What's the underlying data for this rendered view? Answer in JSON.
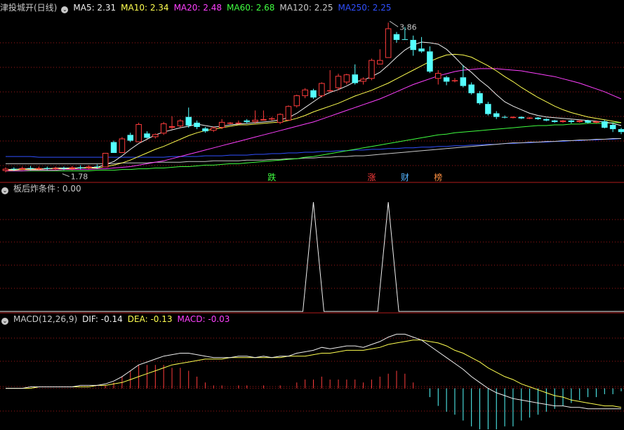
{
  "colors": {
    "background": "#000000",
    "grid": "#a01818",
    "up": "#ff3c3c",
    "down": "#54ffff",
    "text": "#c8c8c8",
    "ma5": "#f0f0f0",
    "ma10": "#ffff50",
    "ma20": "#ff40ff",
    "ma60": "#40ff40",
    "ma120": "#c8c8c8",
    "ma250": "#3050ff",
    "dif": "#f0f0f0",
    "dea": "#ffff50",
    "macd": "#ff40ff"
  },
  "main_panel": {
    "title": "津投城开(日线)",
    "ma_labels": [
      {
        "key": "ma5",
        "text": "MA5: 2.31"
      },
      {
        "key": "ma10",
        "text": "MA10: 2.34"
      },
      {
        "key": "ma20",
        "text": "MA20: 2.48"
      },
      {
        "key": "ma60",
        "text": "MA60: 2.68"
      },
      {
        "key": "ma120",
        "text": "MA120: 2.25"
      },
      {
        "key": "ma250",
        "text": "MA250: 2.25"
      }
    ],
    "high_label": "3.86",
    "low_label": "1.78",
    "markers": [
      {
        "text": "跌",
        "color": "#40ff40",
        "bar": 32
      },
      {
        "text": "涨",
        "color": "#ff3c3c",
        "bar": 44
      },
      {
        "text": "财",
        "color": "#54b4ff",
        "bar": 48
      },
      {
        "text": "榜",
        "color": "#ff9040",
        "bar": 52
      }
    ]
  },
  "indicator_panel": {
    "title": "板后炸条件",
    "value_text": ": 0.00"
  },
  "macd_panel": {
    "title": "MACD(12,26,9)",
    "dif_text": "DIF: -0.14",
    "dea_text": "DEA: -0.13",
    "macd_text": "MACD: -0.03"
  },
  "chart_data": {
    "type": "candlestick",
    "ylim": [
      1.66,
      3.96
    ],
    "candles": [
      [
        1.8,
        1.83,
        1.78,
        1.85
      ],
      [
        1.83,
        1.82,
        1.8,
        1.85
      ],
      [
        1.82,
        1.84,
        1.81,
        1.86
      ],
      [
        1.84,
        1.83,
        1.81,
        1.87
      ],
      [
        1.83,
        1.84,
        1.81,
        1.86
      ],
      [
        1.84,
        1.83,
        1.81,
        1.86
      ],
      [
        1.83,
        1.84,
        1.81,
        1.86
      ],
      [
        1.84,
        1.83,
        1.81,
        1.86
      ],
      [
        1.83,
        1.85,
        1.81,
        1.87
      ],
      [
        1.85,
        1.84,
        1.82,
        1.88
      ],
      [
        1.84,
        1.86,
        1.82,
        1.88
      ],
      [
        1.86,
        1.85,
        1.83,
        1.89
      ],
      [
        1.85,
        2.05,
        1.85,
        2.05
      ],
      [
        2.2,
        2.05,
        2.05,
        2.22
      ],
      [
        2.05,
        2.25,
        2.05,
        2.27
      ],
      [
        2.3,
        2.22,
        2.2,
        2.33
      ],
      [
        2.2,
        2.45,
        2.2,
        2.47
      ],
      [
        2.32,
        2.26,
        2.25,
        2.35
      ],
      [
        2.27,
        2.31,
        2.25,
        2.32
      ],
      [
        2.32,
        2.46,
        2.3,
        2.48
      ],
      [
        2.4,
        2.42,
        2.38,
        2.56
      ],
      [
        2.42,
        2.5,
        2.4,
        2.52
      ],
      [
        2.55,
        2.43,
        2.4,
        2.68
      ],
      [
        2.47,
        2.41,
        2.38,
        2.5
      ],
      [
        2.39,
        2.35,
        2.33,
        2.41
      ],
      [
        2.36,
        2.4,
        2.34,
        2.42
      ],
      [
        2.4,
        2.48,
        2.38,
        2.52
      ],
      [
        2.47,
        2.47,
        2.45,
        2.48
      ],
      [
        2.47,
        2.47,
        2.45,
        2.5
      ],
      [
        2.5,
        2.48,
        2.46,
        2.52
      ],
      [
        2.48,
        2.51,
        2.46,
        2.64
      ],
      [
        2.5,
        2.52,
        2.5,
        2.64
      ],
      [
        2.52,
        2.53,
        2.5,
        2.55
      ],
      [
        2.47,
        2.59,
        2.45,
        2.6
      ],
      [
        2.5,
        2.7,
        2.5,
        2.71
      ],
      [
        2.7,
        2.85,
        2.68,
        2.86
      ],
      [
        2.84,
        2.93,
        2.81,
        2.95
      ],
      [
        2.92,
        2.82,
        2.8,
        2.94
      ],
      [
        2.84,
        3.02,
        2.82,
        3.03
      ],
      [
        2.92,
        2.92,
        2.9,
        3.2
      ],
      [
        2.95,
        3.12,
        2.92,
        3.15
      ],
      [
        3.03,
        3.14,
        3.0,
        3.15
      ],
      [
        3.14,
        3.02,
        3.0,
        3.28
      ],
      [
        3.04,
        3.08,
        3.0,
        3.1
      ],
      [
        3.08,
        3.34,
        3.06,
        3.36
      ],
      [
        3.28,
        3.34,
        3.28,
        3.49
      ],
      [
        3.37,
        3.78,
        3.37,
        3.86
      ],
      [
        3.7,
        3.62,
        3.58,
        3.73
      ],
      [
        3.63,
        3.62,
        3.62,
        3.8
      ],
      [
        3.62,
        3.48,
        3.4,
        3.68
      ],
      [
        3.5,
        3.46,
        3.44,
        3.66
      ],
      [
        3.46,
        3.18,
        3.16,
        3.53
      ],
      [
        3.08,
        3.16,
        3.0,
        3.2
      ],
      [
        3.1,
        3.04,
        2.99,
        3.12
      ],
      [
        3.05,
        3.06,
        3.03,
        3.09
      ],
      [
        3.1,
        2.98,
        2.96,
        3.27
      ],
      [
        3.0,
        2.88,
        2.86,
        3.03
      ],
      [
        2.88,
        2.74,
        2.72,
        2.91
      ],
      [
        2.73,
        2.59,
        2.57,
        2.76
      ],
      [
        2.6,
        2.55,
        2.52,
        2.63
      ],
      [
        2.55,
        2.54,
        2.53,
        2.57
      ],
      [
        2.54,
        2.55,
        2.53,
        2.56
      ],
      [
        2.55,
        2.53,
        2.52,
        2.56
      ],
      [
        2.53,
        2.54,
        2.52,
        2.55
      ],
      [
        2.54,
        2.52,
        2.51,
        2.55
      ],
      [
        2.52,
        2.5,
        2.49,
        2.53
      ],
      [
        2.5,
        2.48,
        2.47,
        2.51
      ],
      [
        2.48,
        2.5,
        2.47,
        2.51
      ],
      [
        2.5,
        2.48,
        2.46,
        2.51
      ],
      [
        2.48,
        2.5,
        2.47,
        2.51
      ],
      [
        2.5,
        2.47,
        2.46,
        2.51
      ],
      [
        2.47,
        2.49,
        2.46,
        2.5
      ],
      [
        2.49,
        2.4,
        2.39,
        2.51
      ],
      [
        2.44,
        2.38,
        2.34,
        2.46
      ],
      [
        2.38,
        2.34,
        2.31,
        2.4
      ]
    ],
    "ma_lines": {
      "ma5": [
        1.82,
        1.82,
        1.83,
        1.83,
        1.83,
        1.83,
        1.84,
        1.84,
        1.84,
        1.84,
        1.85,
        1.85,
        1.89,
        1.93,
        2.01,
        2.1,
        2.18,
        2.24,
        2.3,
        2.34,
        2.37,
        2.4,
        2.42,
        2.45,
        2.43,
        2.41,
        2.42,
        2.44,
        2.45,
        2.46,
        2.47,
        2.48,
        2.49,
        2.51,
        2.54,
        2.6,
        2.68,
        2.76,
        2.84,
        2.89,
        2.93,
        2.98,
        3.04,
        3.06,
        3.11,
        3.17,
        3.27,
        3.38,
        3.48,
        3.55,
        3.59,
        3.58,
        3.56,
        3.49,
        3.38,
        3.26,
        3.17,
        3.06,
        2.97,
        2.86,
        2.76,
        2.7,
        2.65,
        2.6,
        2.57,
        2.55,
        2.54,
        2.53,
        2.52,
        2.51,
        2.5,
        2.49,
        2.48,
        2.46,
        2.43
      ],
      "ma10": [
        1.81,
        1.81,
        1.82,
        1.82,
        1.82,
        1.83,
        1.83,
        1.83,
        1.83,
        1.84,
        1.84,
        1.84,
        1.86,
        1.88,
        1.91,
        1.95,
        2.0,
        2.05,
        2.1,
        2.14,
        2.19,
        2.24,
        2.29,
        2.33,
        2.36,
        2.38,
        2.4,
        2.42,
        2.44,
        2.44,
        2.45,
        2.46,
        2.47,
        2.48,
        2.5,
        2.53,
        2.57,
        2.62,
        2.66,
        2.7,
        2.74,
        2.79,
        2.84,
        2.88,
        2.92,
        2.97,
        3.02,
        3.08,
        3.14,
        3.2,
        3.26,
        3.32,
        3.37,
        3.41,
        3.42,
        3.41,
        3.38,
        3.32,
        3.26,
        3.19,
        3.11,
        3.04,
        2.96,
        2.89,
        2.82,
        2.76,
        2.7,
        2.65,
        2.61,
        2.58,
        2.55,
        2.53,
        2.51,
        2.49,
        2.47
      ],
      "ma20": [
        1.8,
        1.8,
        1.8,
        1.81,
        1.81,
        1.81,
        1.81,
        1.82,
        1.82,
        1.82,
        1.82,
        1.83,
        1.83,
        1.84,
        1.85,
        1.86,
        1.88,
        1.9,
        1.92,
        1.94,
        1.97,
        2.0,
        2.03,
        2.06,
        2.09,
        2.12,
        2.15,
        2.18,
        2.21,
        2.24,
        2.27,
        2.3,
        2.33,
        2.36,
        2.39,
        2.42,
        2.45,
        2.48,
        2.52,
        2.56,
        2.6,
        2.64,
        2.68,
        2.72,
        2.76,
        2.8,
        2.85,
        2.9,
        2.95,
        3.0,
        3.04,
        3.08,
        3.12,
        3.15,
        3.18,
        3.2,
        3.21,
        3.22,
        3.22,
        3.22,
        3.21,
        3.2,
        3.19,
        3.17,
        3.15,
        3.13,
        3.11,
        3.08,
        3.05,
        3.02,
        2.98,
        2.94,
        2.9,
        2.85,
        2.8
      ],
      "ma60": [
        1.8,
        1.8,
        1.8,
        1.8,
        1.8,
        1.8,
        1.8,
        1.8,
        1.8,
        1.8,
        1.8,
        1.81,
        1.81,
        1.81,
        1.82,
        1.82,
        1.83,
        1.83,
        1.84,
        1.84,
        1.85,
        1.86,
        1.86,
        1.87,
        1.88,
        1.88,
        1.89,
        1.9,
        1.9,
        1.91,
        1.92,
        1.93,
        1.94,
        1.95,
        1.96,
        1.97,
        1.99,
        2.0,
        2.02,
        2.04,
        2.06,
        2.08,
        2.1,
        2.12,
        2.14,
        2.16,
        2.18,
        2.2,
        2.22,
        2.24,
        2.26,
        2.28,
        2.3,
        2.31,
        2.33,
        2.34,
        2.35,
        2.36,
        2.37,
        2.38,
        2.39,
        2.4,
        2.41,
        2.42,
        2.43,
        2.43,
        2.44,
        2.44,
        2.45,
        2.45,
        2.46,
        2.46,
        2.46,
        2.47,
        2.47
      ],
      "ma120": [
        1.9,
        1.9,
        1.9,
        1.9,
        1.9,
        1.9,
        1.9,
        1.9,
        1.9,
        1.9,
        1.9,
        1.9,
        1.9,
        1.9,
        1.91,
        1.91,
        1.91,
        1.91,
        1.92,
        1.92,
        1.92,
        1.92,
        1.93,
        1.93,
        1.93,
        1.94,
        1.94,
        1.94,
        1.94,
        1.95,
        1.95,
        1.95,
        1.96,
        1.96,
        1.97,
        1.97,
        1.98,
        1.98,
        1.99,
        1.99,
        2.0,
        2.0,
        2.01,
        2.01,
        2.02,
        2.03,
        2.04,
        2.05,
        2.06,
        2.07,
        2.08,
        2.09,
        2.1,
        2.11,
        2.12,
        2.13,
        2.14,
        2.15,
        2.16,
        2.17,
        2.18,
        2.19,
        2.19,
        2.2,
        2.2,
        2.21,
        2.21,
        2.22,
        2.22,
        2.23,
        2.23,
        2.24,
        2.24,
        2.25,
        2.25
      ],
      "ma250": [
        2.0,
        2.0,
        2.0,
        2.0,
        1.99,
        1.99,
        1.99,
        1.99,
        1.99,
        1.99,
        1.99,
        1.99,
        1.99,
        1.99,
        1.99,
        1.99,
        1.99,
        1.99,
        1.99,
        1.99,
        2.0,
        2.0,
        2.0,
        2.0,
        2.01,
        2.01,
        2.01,
        2.02,
        2.02,
        2.02,
        2.03,
        2.03,
        2.04,
        2.04,
        2.05,
        2.05,
        2.06,
        2.06,
        2.07,
        2.07,
        2.08,
        2.08,
        2.09,
        2.09,
        2.1,
        2.1,
        2.11,
        2.11,
        2.12,
        2.12,
        2.13,
        2.13,
        2.14,
        2.14,
        2.15,
        2.15,
        2.16,
        2.16,
        2.17,
        2.17,
        2.18,
        2.18,
        2.19,
        2.19,
        2.2,
        2.2,
        2.21,
        2.21,
        2.22,
        2.22,
        2.23,
        2.23,
        2.24,
        2.24,
        2.25
      ]
    },
    "indicator": {
      "ylim": [
        0,
        1.04
      ],
      "values": [
        0,
        0,
        0,
        0,
        0,
        0,
        0,
        0,
        0,
        0,
        0,
        0,
        0,
        0,
        0,
        0,
        0,
        0,
        0,
        0,
        0,
        0,
        0,
        0,
        0,
        0,
        0,
        0,
        0,
        0,
        0,
        0,
        0,
        0,
        0,
        0,
        0,
        1,
        0,
        0,
        0,
        0,
        0,
        0,
        0,
        0,
        1,
        0,
        0,
        0,
        0,
        0,
        0,
        0,
        0,
        0,
        0,
        0,
        0,
        0,
        0,
        0,
        0,
        0,
        0,
        0,
        0,
        0,
        0,
        0,
        0,
        0,
        0,
        0,
        0
      ]
    },
    "macd": {
      "ylim": [
        -0.28,
        0.42
      ],
      "dif": [
        0.0,
        0.0,
        0.0,
        0.01,
        0.01,
        0.01,
        0.01,
        0.01,
        0.01,
        0.02,
        0.02,
        0.02,
        0.03,
        0.05,
        0.08,
        0.12,
        0.16,
        0.18,
        0.2,
        0.22,
        0.23,
        0.24,
        0.24,
        0.23,
        0.22,
        0.21,
        0.21,
        0.21,
        0.22,
        0.22,
        0.21,
        0.22,
        0.21,
        0.22,
        0.22,
        0.24,
        0.25,
        0.26,
        0.28,
        0.27,
        0.28,
        0.29,
        0.29,
        0.28,
        0.3,
        0.32,
        0.35,
        0.37,
        0.37,
        0.35,
        0.33,
        0.29,
        0.25,
        0.21,
        0.17,
        0.13,
        0.08,
        0.04,
        0.0,
        -0.03,
        -0.05,
        -0.07,
        -0.08,
        -0.09,
        -0.1,
        -0.11,
        -0.12,
        -0.12,
        -0.13,
        -0.13,
        -0.14,
        -0.14,
        -0.14,
        -0.14,
        -0.14
      ],
      "dea": [
        0.0,
        0.0,
        0.0,
        0.0,
        0.01,
        0.01,
        0.01,
        0.01,
        0.01,
        0.01,
        0.01,
        0.02,
        0.02,
        0.03,
        0.04,
        0.06,
        0.08,
        0.1,
        0.12,
        0.14,
        0.16,
        0.17,
        0.18,
        0.19,
        0.2,
        0.2,
        0.2,
        0.21,
        0.21,
        0.21,
        0.21,
        0.21,
        0.21,
        0.21,
        0.22,
        0.22,
        0.22,
        0.23,
        0.24,
        0.24,
        0.25,
        0.26,
        0.26,
        0.26,
        0.27,
        0.28,
        0.3,
        0.31,
        0.32,
        0.33,
        0.33,
        0.32,
        0.31,
        0.29,
        0.26,
        0.24,
        0.21,
        0.18,
        0.14,
        0.11,
        0.08,
        0.06,
        0.03,
        0.01,
        -0.01,
        -0.03,
        -0.05,
        -0.06,
        -0.08,
        -0.09,
        -0.1,
        -0.11,
        -0.12,
        -0.12,
        -0.13
      ],
      "hist": [
        0.0,
        0.0,
        0.0,
        0.0,
        0.0,
        0.0,
        0.0,
        0.0,
        0.0,
        0.0,
        0.0,
        0.0,
        0.02,
        0.04,
        0.08,
        0.12,
        0.16,
        0.16,
        0.16,
        0.16,
        0.14,
        0.14,
        0.12,
        0.08,
        0.04,
        0.02,
        0.02,
        0.0,
        0.02,
        0.02,
        0.0,
        0.02,
        0.0,
        0.02,
        0.0,
        0.04,
        0.06,
        0.06,
        0.08,
        0.06,
        0.06,
        0.06,
        0.06,
        0.04,
        0.06,
        0.08,
        0.1,
        0.12,
        0.1,
        0.04,
        0.0,
        -0.06,
        -0.12,
        -0.16,
        -0.18,
        -0.22,
        -0.26,
        -0.28,
        -0.28,
        -0.28,
        -0.26,
        -0.26,
        -0.22,
        -0.2,
        -0.18,
        -0.16,
        -0.14,
        -0.12,
        -0.1,
        -0.08,
        -0.06,
        -0.06,
        -0.04,
        -0.04,
        -0.02
      ]
    }
  }
}
